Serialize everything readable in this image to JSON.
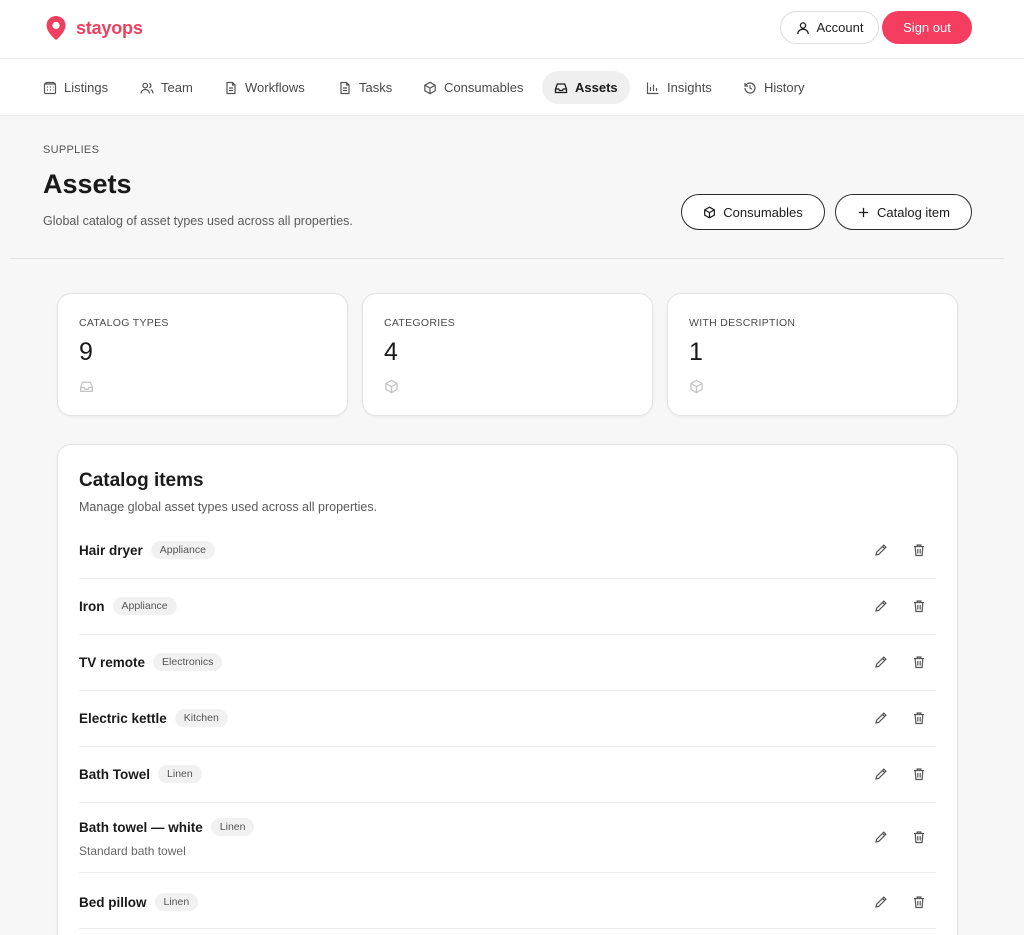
{
  "brand": {
    "name": "stayops",
    "accent": "#f43d5f"
  },
  "topbar": {
    "account_label": "Account",
    "signout_label": "Sign out"
  },
  "nav": [
    {
      "label": "Listings",
      "icon": "building-icon"
    },
    {
      "label": "Team",
      "icon": "users-icon"
    },
    {
      "label": "Workflows",
      "icon": "file-icon"
    },
    {
      "label": "Tasks",
      "icon": "file-icon"
    },
    {
      "label": "Consumables",
      "icon": "box-icon"
    },
    {
      "label": "Assets",
      "icon": "tray-icon",
      "active": true
    },
    {
      "label": "Insights",
      "icon": "bar-chart-icon"
    },
    {
      "label": "History",
      "icon": "history-icon"
    }
  ],
  "header": {
    "eyebrow": "SUPPLIES",
    "title": "Assets",
    "description": "Global catalog of asset types used across all properties.",
    "consumables_button": "Consumables",
    "catalog_item_button": "Catalog item"
  },
  "stats": [
    {
      "label": "CATALOG TYPES",
      "value": "9",
      "icon": "tray-icon"
    },
    {
      "label": "CATEGORIES",
      "value": "4",
      "icon": "box-icon"
    },
    {
      "label": "WITH DESCRIPTION",
      "value": "1",
      "icon": "box-icon"
    }
  ],
  "catalog": {
    "title": "Catalog items",
    "description": "Manage global asset types used across all properties.",
    "items": [
      {
        "name": "Hair dryer",
        "category": "Appliance"
      },
      {
        "name": "Iron",
        "category": "Appliance"
      },
      {
        "name": "TV remote",
        "category": "Electronics"
      },
      {
        "name": "Electric kettle",
        "category": "Kitchen"
      },
      {
        "name": "Bath Towel",
        "category": "Linen"
      },
      {
        "name": "Bath towel — white",
        "category": "Linen",
        "description": "Standard bath towel"
      },
      {
        "name": "Bed pillow",
        "category": "Linen"
      }
    ]
  }
}
